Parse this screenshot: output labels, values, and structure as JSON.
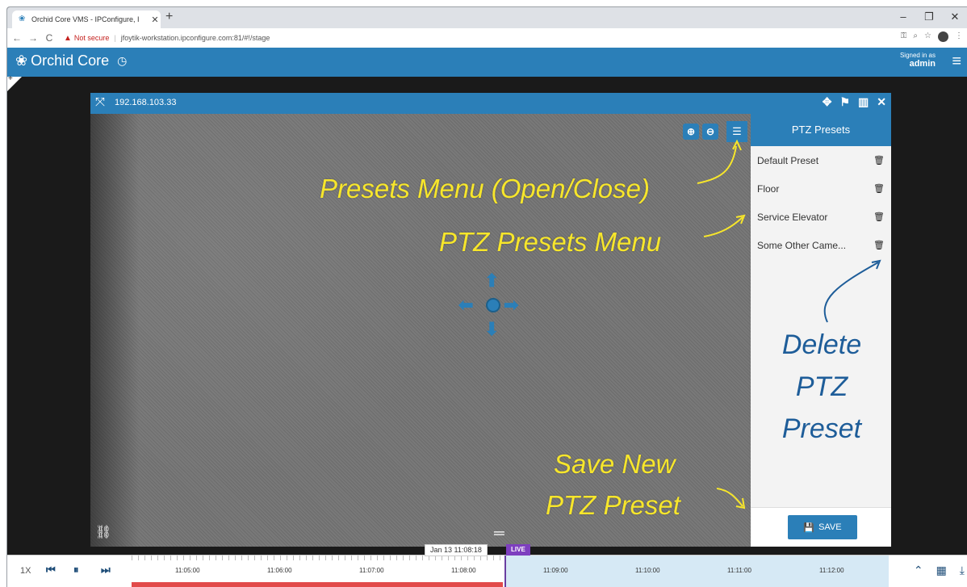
{
  "browser": {
    "tab_title": "Orchid Core VMS - IPConfigure, I",
    "tab_close": "✕",
    "new_tab": "+",
    "security_label": "Not secure",
    "url": "jfoytik-workstation.ipconfigure.com:81/#!/stage"
  },
  "app": {
    "name": "Orchid Core",
    "signed_in_label": "Signed in as",
    "username": "admin"
  },
  "camera": {
    "ip": "192.168.103.33"
  },
  "presets": {
    "title": "PTZ Presets",
    "items": [
      {
        "name": "Default Preset"
      },
      {
        "name": "Floor"
      },
      {
        "name": "Service Elevator"
      },
      {
        "name": "Some Other Came..."
      }
    ],
    "save_label": "SAVE"
  },
  "annotations": {
    "presets_menu_toggle": "Presets Menu (Open/Close)",
    "presets_menu": "PTZ  Presets Menu",
    "delete_line1": "Delete",
    "delete_line2": "PTZ",
    "delete_line3": "Preset",
    "save_line1": "Save New",
    "save_line2": "PTZ Preset"
  },
  "timeline": {
    "speed": "1X",
    "current_time": "Jan 13 11:08:18",
    "live_label": "LIVE",
    "ticks": [
      "11:05:00",
      "11:06:00",
      "11:07:00",
      "11:08:00",
      "11:09:00",
      "11:10:00",
      "11:11:00",
      "11:12:00"
    ]
  },
  "colors": {
    "primary": "#2b7fb8",
    "annotation_yellow": "#f7e62b",
    "annotation_blue": "#1e5d99",
    "live_purple": "#7e3fbf",
    "recording_red": "#e24a4a"
  }
}
